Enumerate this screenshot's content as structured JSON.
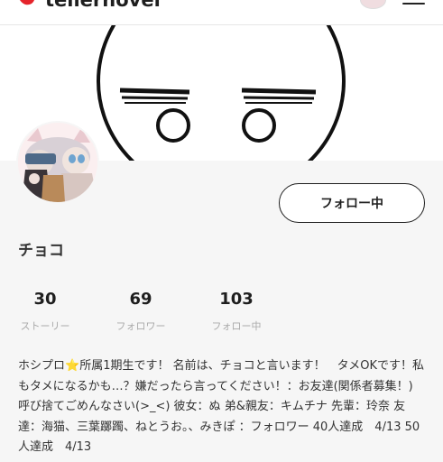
{
  "nav": {
    "logo_text": "tellernovel",
    "brand_color": "#e5242b"
  },
  "profile": {
    "name": "チョコ",
    "follow_button": "フォロー中",
    "stats": [
      {
        "value": "30",
        "label": "ストーリー"
      },
      {
        "value": "69",
        "label": "フォロワー"
      },
      {
        "value": "103",
        "label": "フォロー中"
      }
    ],
    "bio": {
      "before_emoji": "ホシプロ",
      "emoji": "⭐",
      "after_emoji": "所属1期生です！ 名前は、チョコと言います！　タメOKです！私もタメになるかも…？嫌だったら言ってください！：お友達(関係者募集！) 呼び捨てごめんなさい(>_<) 彼女：ぬ 弟&親友：キムチナ 先輩：玲奈 友達：海猫、三葉躑躅、ねとうお。、みきぽ ：フォロワー 40人達成　4/13 50人達成　4/13"
    }
  }
}
